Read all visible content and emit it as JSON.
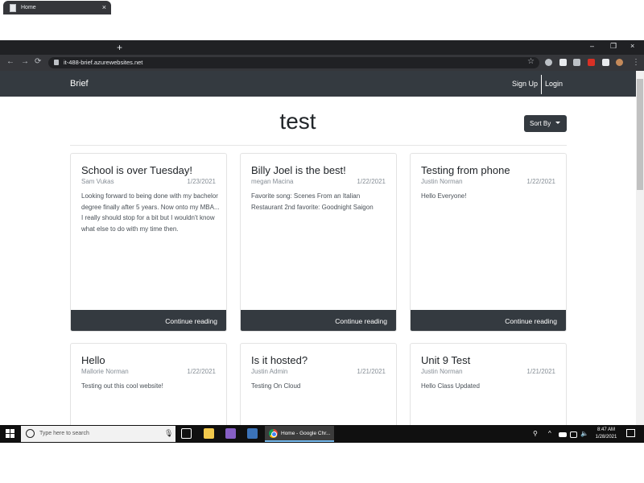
{
  "browser": {
    "tab_title": "Home",
    "tab_close": "×",
    "new_tab": "+",
    "url": "it-488-brief.azurewebsites.net",
    "window_controls": [
      "–",
      "❐",
      "×"
    ],
    "nav": [
      "←",
      "→",
      "⟳"
    ],
    "star": "☆"
  },
  "site": {
    "brand": "Brief",
    "sign_up": "Sign Up",
    "login": "Login",
    "page_title": "test",
    "sort_label": "Sort By",
    "continue_label": "Continue reading"
  },
  "cards": [
    {
      "title": "School is over Tuesday!",
      "author": "Sam Vukas",
      "date": "1/23/2021",
      "body": "Looking forward to being done with my bachelor degree finally after 5 years. Now onto my MBA... I really should stop for a bit but I wouldn't know what else to do with my time then."
    },
    {
      "title": "Billy Joel is the best!",
      "author": "megan Macina",
      "date": "1/22/2021",
      "body": "Favorite song: Scenes From an Italian Restaurant 2nd favorite: Goodnight Saigon"
    },
    {
      "title": "Testing from phone",
      "author": "Justin Norman",
      "date": "1/22/2021",
      "body": "Hello Everyone!"
    },
    {
      "title": "Hello",
      "author": "Mallorie Norman",
      "date": "1/22/2021",
      "body": "Testing out this cool website!"
    },
    {
      "title": "Is it hosted?",
      "author": "Justin Admin",
      "date": "1/21/2021",
      "body": "Testing On Cloud"
    },
    {
      "title": "Unit 9 Test",
      "author": "Justin Norman",
      "date": "1/21/2021",
      "body": "Hello Class Updated"
    }
  ],
  "taskbar": {
    "search_placeholder": "Type here to search",
    "chrome_label": "Home - Google Chr...",
    "time": "8:47 AM",
    "date": "1/28/2021"
  },
  "colors": {
    "navbar": "#343a40",
    "chrome_dark": "#202124",
    "taskbar": "#101010"
  }
}
